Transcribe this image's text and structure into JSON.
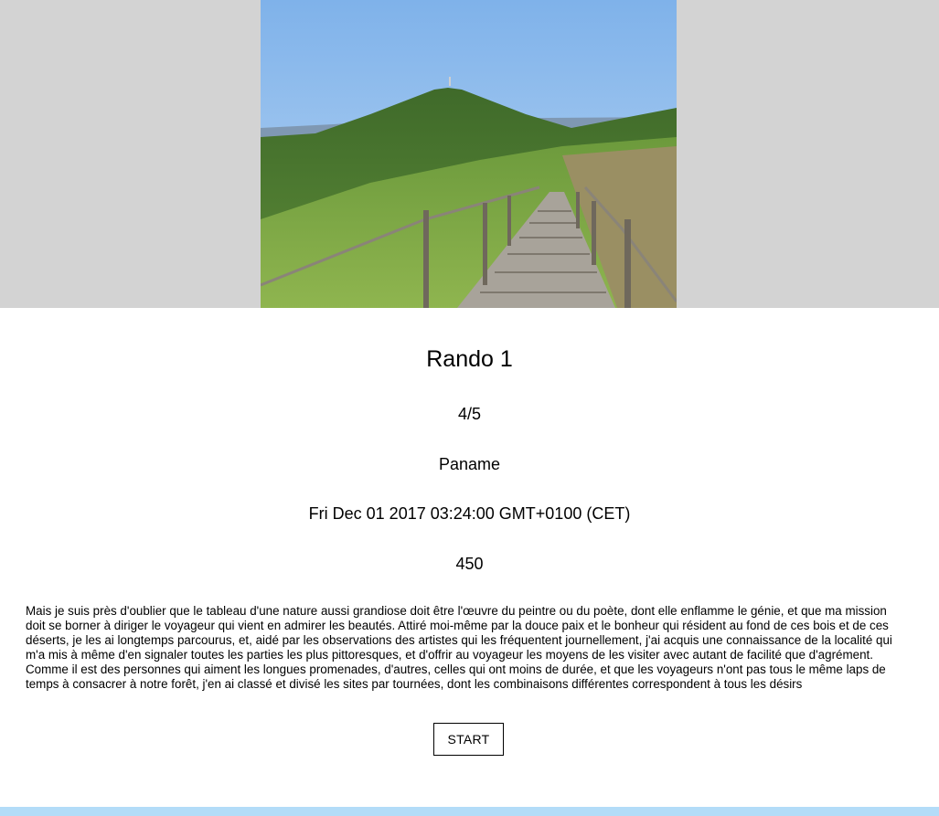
{
  "hike": {
    "title": "Rando 1",
    "difficulty": "4/5",
    "city": "Paname",
    "date": "Fri Dec 01 2017 03:24:00 GMT+0100 (CET)",
    "distance": "450",
    "description": "Mais je suis près d'oublier que le tableau d'une nature aussi grandiose doit être l'œuvre du peintre ou du poète, dont elle enflamme le génie, et que ma mission doit se borner à diriger le voyageur qui vient en admirer les beautés. Attiré moi-même par la douce paix et le bonheur qui résident au fond de ces bois et de ces déserts, je les ai longtemps parcourus, et, aidé par les observations des artistes qui les fréquentent journellement, j'ai acquis une connaissance de la localité qui m'a mis à même d'en signaler toutes les parties les plus pittoresques, et d'offrir au voyageur les moyens de les visiter avec autant de facilité que d'agrément. Comme il est des personnes qui aiment les longues promenades, d'autres, celles qui ont moins de durée, et que les voyageurs n'ont pas tous le même laps de temps à consacrer à notre forêt, j'en ai classé et divisé les sites par tournées, dont les combinaisons différentes correspondent à tous les désirs",
    "start_label": "START"
  },
  "colors": {
    "hero_background": "#d3d3d3",
    "bottom_bar": "#b3dcf8"
  }
}
